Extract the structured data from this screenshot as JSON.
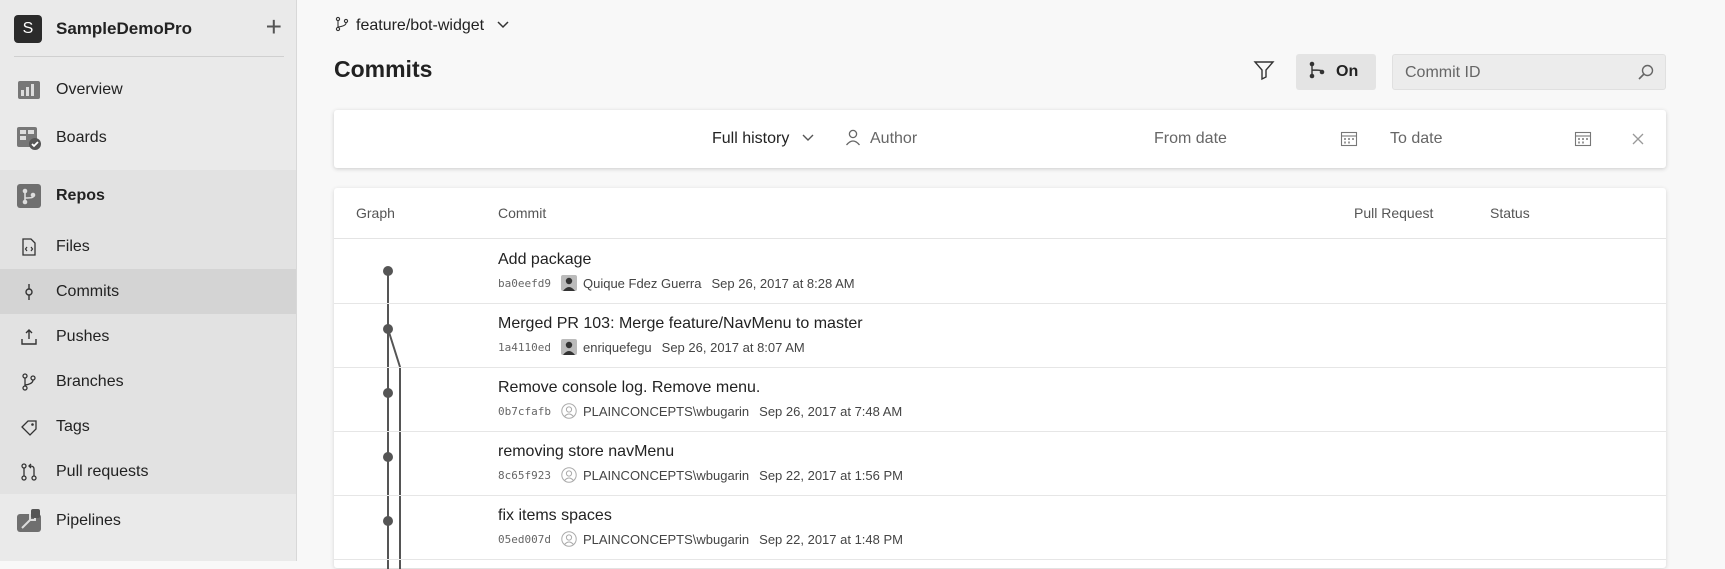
{
  "project": {
    "initial": "S",
    "name": "SampleDemoPro",
    "add_label": "+"
  },
  "nav": {
    "overview": "Overview",
    "boards": "Boards",
    "repos": "Repos",
    "files": "Files",
    "commits": "Commits",
    "pushes": "Pushes",
    "branches": "Branches",
    "tags": "Tags",
    "pull_requests": "Pull requests",
    "pipelines": "Pipelines"
  },
  "branch": {
    "name": "feature/bot-widget"
  },
  "page": {
    "title": "Commits"
  },
  "toolbar": {
    "graph_toggle": "On",
    "search_placeholder": "Commit ID"
  },
  "filters": {
    "history": "Full history",
    "author": "Author",
    "from_date": "From date",
    "to_date": "To date"
  },
  "table": {
    "headers": {
      "graph": "Graph",
      "commit": "Commit",
      "pull_request": "Pull Request",
      "status": "Status"
    },
    "rows": [
      {
        "message": "Add package",
        "hash": "ba0eefd9",
        "author": "Quique Fdez Guerra",
        "date": "Sep 26, 2017 at 8:28 AM",
        "avatar": "photo"
      },
      {
        "message": "Merged PR 103: Merge feature/NavMenu to master",
        "hash": "1a4110ed",
        "author": "enriquefegu",
        "date": "Sep 26, 2017 at 8:07 AM",
        "avatar": "photo"
      },
      {
        "message": "Remove console log. Remove menu.",
        "hash": "0b7cfafb",
        "author": "PLAINCONCEPTS\\wbugarin",
        "date": "Sep 26, 2017 at 7:48 AM",
        "avatar": "placeholder"
      },
      {
        "message": "removing store navMenu",
        "hash": "8c65f923",
        "author": "PLAINCONCEPTS\\wbugarin",
        "date": "Sep 22, 2017 at 1:56 PM",
        "avatar": "placeholder"
      },
      {
        "message": "fix items spaces",
        "hash": "05ed007d",
        "author": "PLAINCONCEPTS\\wbugarin",
        "date": "Sep 22, 2017 at 1:48 PM",
        "avatar": "placeholder"
      }
    ]
  },
  "colors": {
    "graph_line": "#555555",
    "sidebar_bg": "#eaeaea",
    "active_item": "#d4d4d4"
  }
}
